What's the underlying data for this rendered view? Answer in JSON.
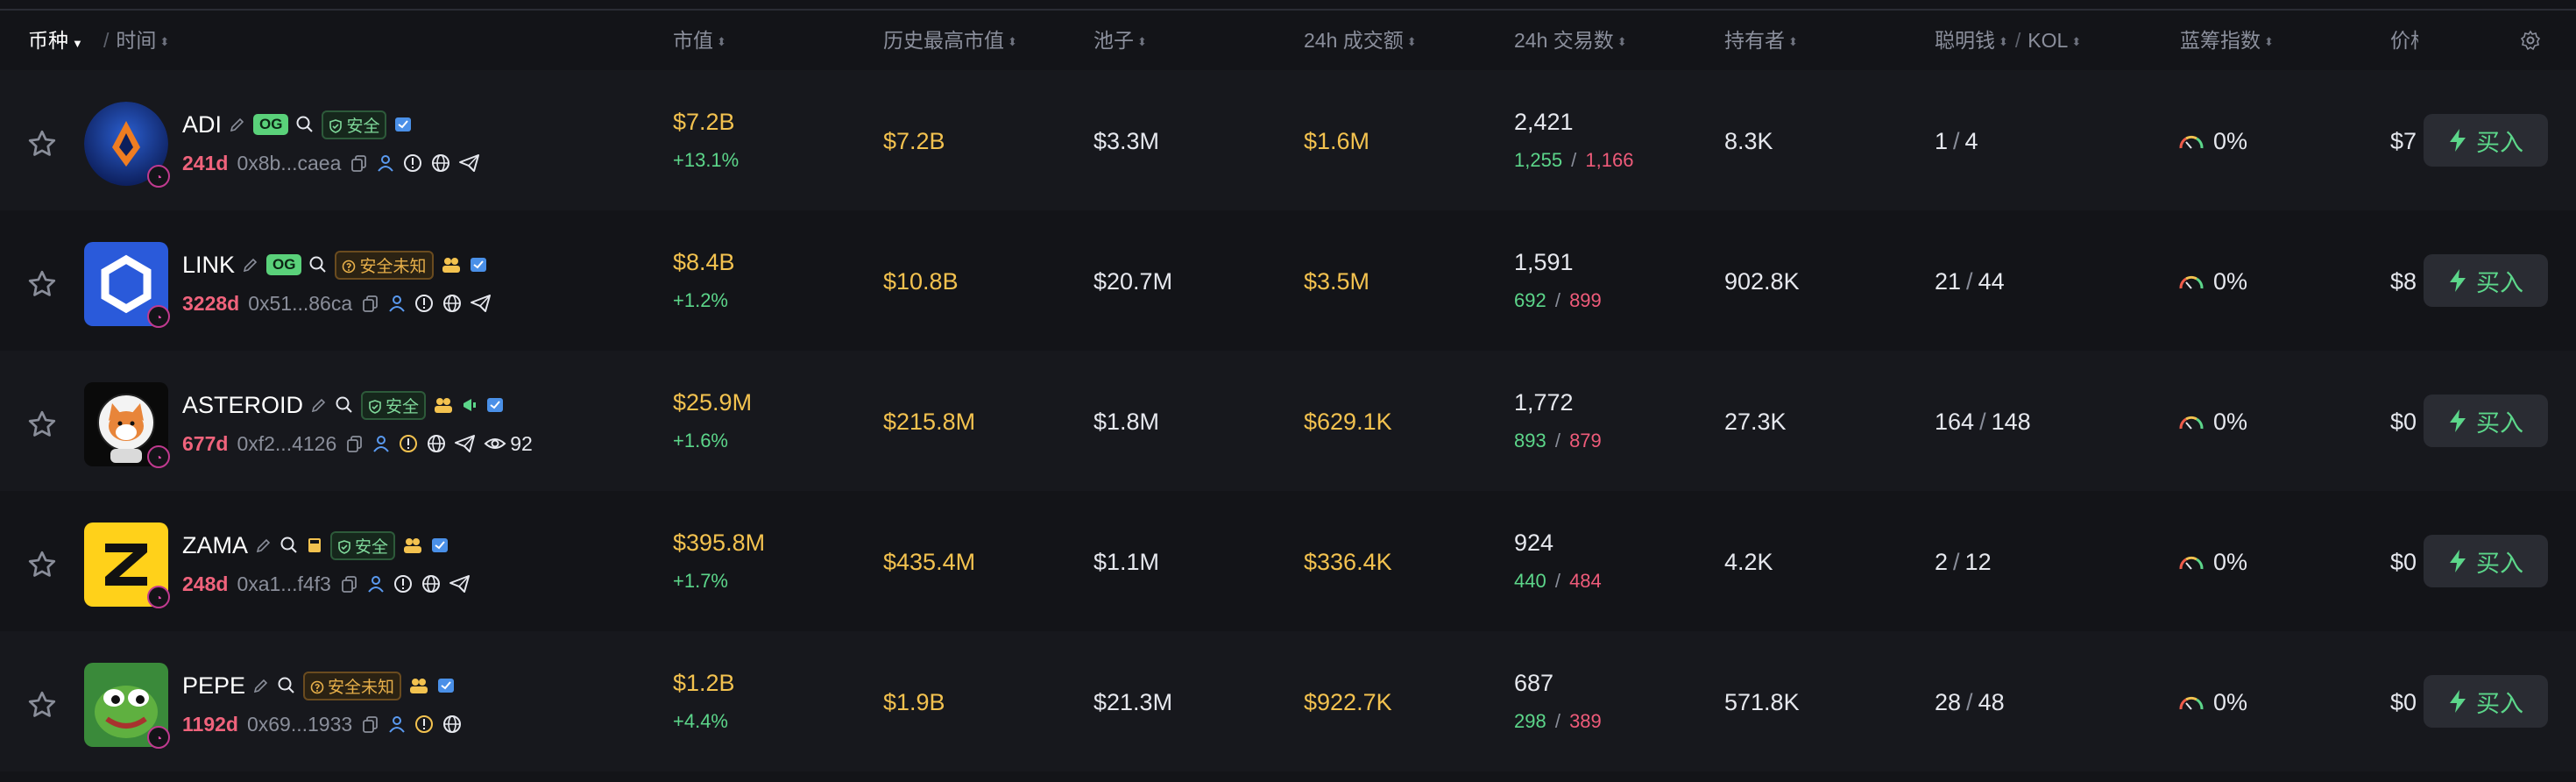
{
  "colors": {
    "background": "#131418",
    "row_alt": "#17181d",
    "gold": "#f3c24f",
    "green": "#5cd68a",
    "red": "#ef5b7a",
    "age_pink": "#f0637c",
    "muted": "#8a8e9a"
  },
  "header": {
    "token": "币种",
    "sep": "/",
    "time": "时间",
    "market_cap": "市值",
    "ath_market_cap": "历史最高市值",
    "pool": "池子",
    "volume_24h": "24h 成交额",
    "txns_24h": "24h 交易数",
    "holders": "持有者",
    "smart_money": "聪明钱",
    "kol": "KOL",
    "bluechip": "蓝筹指数",
    "price": "价格"
  },
  "rows": [
    {
      "name": "ADI",
      "og": "OG",
      "safety": "安全",
      "safety_type": "safe",
      "age": "241d",
      "address": "0x8b...caea",
      "views": "",
      "market_cap": "$7.2B",
      "change": "+13.1%",
      "ath": "$7.2B",
      "pool": "$3.3M",
      "volume": "$1.6M",
      "txns": "2,421",
      "buys": "1,255",
      "sells": "1,166",
      "holders": "8.3K",
      "smart": "1",
      "kol": "4",
      "bluechip": "0%",
      "price": "$7",
      "buy_label": "买入",
      "avatar_icon": "adi-logo-icon"
    },
    {
      "name": "LINK",
      "og": "OG",
      "safety": "安全未知",
      "safety_type": "unknown",
      "age": "3228d",
      "address": "0x51...86ca",
      "views": "",
      "market_cap": "$8.4B",
      "change": "+1.2%",
      "ath": "$10.8B",
      "pool": "$20.7M",
      "volume": "$3.5M",
      "txns": "1,591",
      "buys": "692",
      "sells": "899",
      "holders": "902.8K",
      "smart": "21",
      "kol": "44",
      "bluechip": "0%",
      "price": "$8",
      "buy_label": "买入",
      "avatar_icon": "chainlink-logo-icon"
    },
    {
      "name": "ASTEROID",
      "og": "",
      "safety": "安全",
      "safety_type": "safe",
      "age": "677d",
      "address": "0xf2...4126",
      "views": "92",
      "market_cap": "$25.9M",
      "change": "+1.6%",
      "ath": "$215.8M",
      "pool": "$1.8M",
      "volume": "$629.1K",
      "txns": "1,772",
      "buys": "893",
      "sells": "879",
      "holders": "27.3K",
      "smart": "164",
      "kol": "148",
      "bluechip": "0%",
      "price": "$0",
      "buy_label": "买入",
      "avatar_icon": "shiba-astronaut-icon"
    },
    {
      "name": "ZAMA",
      "og": "",
      "safety": "安全",
      "safety_type": "safe",
      "age": "248d",
      "address": "0xa1...f4f3",
      "views": "",
      "market_cap": "$395.8M",
      "change": "+1.7%",
      "ath": "$435.4M",
      "pool": "$1.1M",
      "volume": "$336.4K",
      "txns": "924",
      "buys": "440",
      "sells": "484",
      "holders": "4.2K",
      "smart": "2",
      "kol": "12",
      "bluechip": "0%",
      "price": "$0",
      "buy_label": "买入",
      "avatar_icon": "zama-logo-icon"
    },
    {
      "name": "PEPE",
      "og": "",
      "safety": "安全未知",
      "safety_type": "unknown",
      "age": "1192d",
      "address": "0x69...1933",
      "views": "",
      "market_cap": "$1.2B",
      "change": "+4.4%",
      "ath": "$1.9B",
      "pool": "$21.3M",
      "volume": "$922.7K",
      "txns": "687",
      "buys": "298",
      "sells": "389",
      "holders": "571.8K",
      "smart": "28",
      "kol": "48",
      "bluechip": "0%",
      "price": "$0",
      "buy_label": "买入",
      "avatar_icon": "pepe-frog-icon"
    }
  ]
}
